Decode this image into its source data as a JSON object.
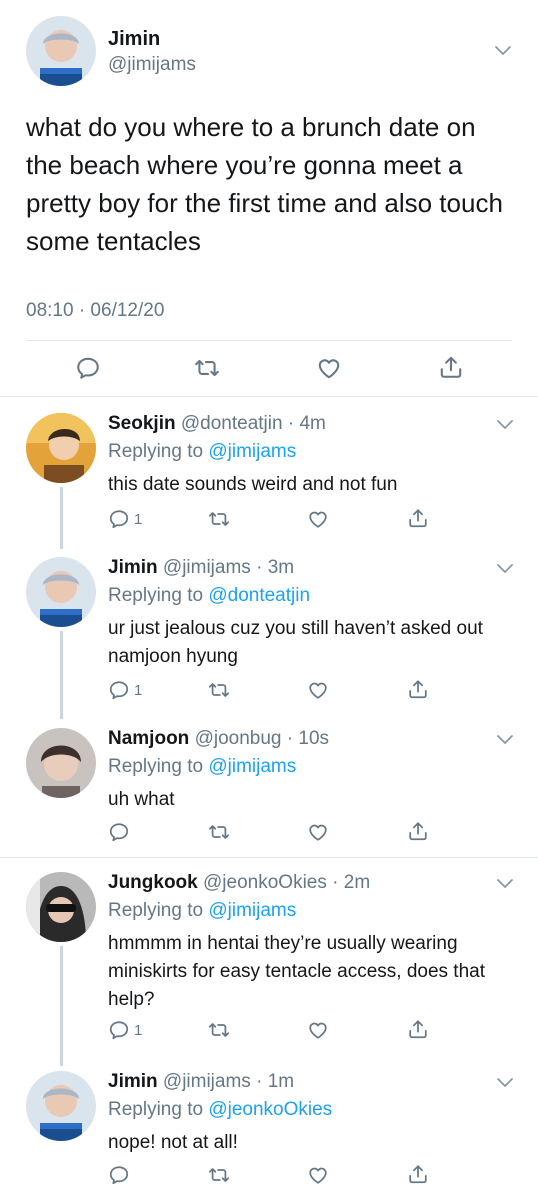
{
  "main_tweet": {
    "name": "Jimin",
    "handle": "@jimijams",
    "text": "what do you where to a brunch date on the beach where you’re gonna meet a pretty boy for the first time and also touch some tentacles",
    "timestamp": "08:10 · 06/12/20"
  },
  "replies": [
    {
      "name": "Seokjin",
      "handle": "@donteatjin",
      "time": "· 4m",
      "replying_label": "Replying to",
      "replying_to": "@jimijams",
      "text": "this date sounds weird and not fun",
      "reply_count": "1"
    },
    {
      "name": "Jimin",
      "handle": "@jimijams",
      "time": "· 3m",
      "replying_label": "Replying to",
      "replying_to": "@donteatjin",
      "text": "ur just jealous cuz you still haven’t asked out namjoon hyung",
      "reply_count": "1"
    },
    {
      "name": "Namjoon",
      "handle": "@joonbug",
      "time": "· 10s",
      "replying_label": "Replying to",
      "replying_to": "@jimijams",
      "text": "uh what",
      "reply_count": ""
    },
    {
      "name": "Jungkook",
      "handle": "@jeonkoOkies",
      "time": "· 2m",
      "replying_label": "Replying to",
      "replying_to": "@jimijams",
      "text": "hmmmm in hentai they’re usually wearing miniskirts for easy tentacle access, does that help?",
      "reply_count": "1"
    },
    {
      "name": "Jimin",
      "handle": "@jimijams",
      "time": "· 1m",
      "replying_label": "Replying to",
      "replying_to": "@jeonkoOkies",
      "text": "nope! not at all!",
      "reply_count": ""
    }
  ],
  "icons": {
    "reply": "reply-icon",
    "retweet": "retweet-icon",
    "like": "like-icon",
    "share": "share-icon",
    "menu": "chevron-down-icon"
  },
  "colors": {
    "accent": "#1da1f2",
    "secondary_text": "#657786",
    "divider": "#e1e8ed",
    "thread_line": "#ccd6dd"
  }
}
